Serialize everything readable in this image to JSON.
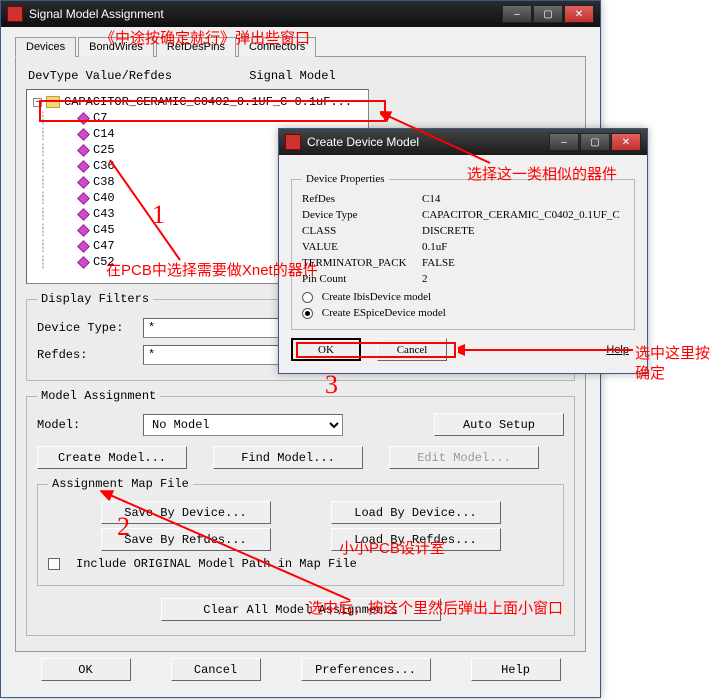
{
  "main": {
    "title": "Signal Model Assignment",
    "tabs": [
      "Devices",
      "BondWires",
      "RefDesPins",
      "Connectors"
    ],
    "headers": {
      "devtype": "DevType Value/Refdes",
      "model": "Signal Model"
    },
    "tree_root": "CAPACITOR_CERAMIC_C0402_0.1UF_C 0.1uF...",
    "tree_items": [
      "C7",
      "C14",
      "C25",
      "C36",
      "C38",
      "C40",
      "C43",
      "C45",
      "C47",
      "C52"
    ],
    "filters_legend": "Display Filters",
    "device_type_label": "Device Type:",
    "device_type_value": "*",
    "refdes_label": "Refdes:",
    "refdes_value": "*",
    "assignment_legend": "Model Assignment",
    "model_label": "Model:",
    "model_value": "No Model",
    "auto_setup": "Auto Setup",
    "create_model": "Create Model...",
    "find_model": "Find Model...",
    "edit_model": "Edit Model...",
    "mapfile_legend": "Assignment Map File",
    "save_by_device": "Save By Device...",
    "load_by_device": "Load By Device...",
    "save_by_refdes": "Save By Refdes...",
    "load_by_refdes": "Load By Refdes...",
    "include_original": "Include ORIGINAL Model Path in Map File",
    "clear_all": "Clear All Model Assignments",
    "ok": "OK",
    "cancel": "Cancel",
    "preferences": "Preferences...",
    "help": "Help"
  },
  "modal": {
    "title": "Create Device Model",
    "props_legend": "Device Properties",
    "refdes_k": "RefDes",
    "refdes_v": "C14",
    "devtype_k": "Device Type",
    "devtype_v": "CAPACITOR_CERAMIC_C0402_0.1UF_C",
    "class_k": "CLASS",
    "class_v": "DISCRETE",
    "value_k": "VALUE",
    "value_v": "0.1uF",
    "term_k": "TERMINATOR_PACK",
    "term_v": "FALSE",
    "pins_k": "Pin Count",
    "pins_v": "2",
    "radio_ibis": "Create IbisDevice model",
    "radio_espice": "Create ESpiceDevice model",
    "ok": "OK",
    "cancel": "Cancel",
    "help": "Help"
  },
  "anno": {
    "a1": "《中途按确定就行》弹出些窗口",
    "a2": "选择这一类相似的器件",
    "a3": "在PCB中选择需要做Xnet的器件",
    "a4": "选中这里按",
    "a5": "确定",
    "a6": "小小PCB设计室",
    "a7": "选中后，按这个里然后弹出上面小窗口",
    "n1": "1",
    "n2": "2",
    "n3": "3"
  }
}
